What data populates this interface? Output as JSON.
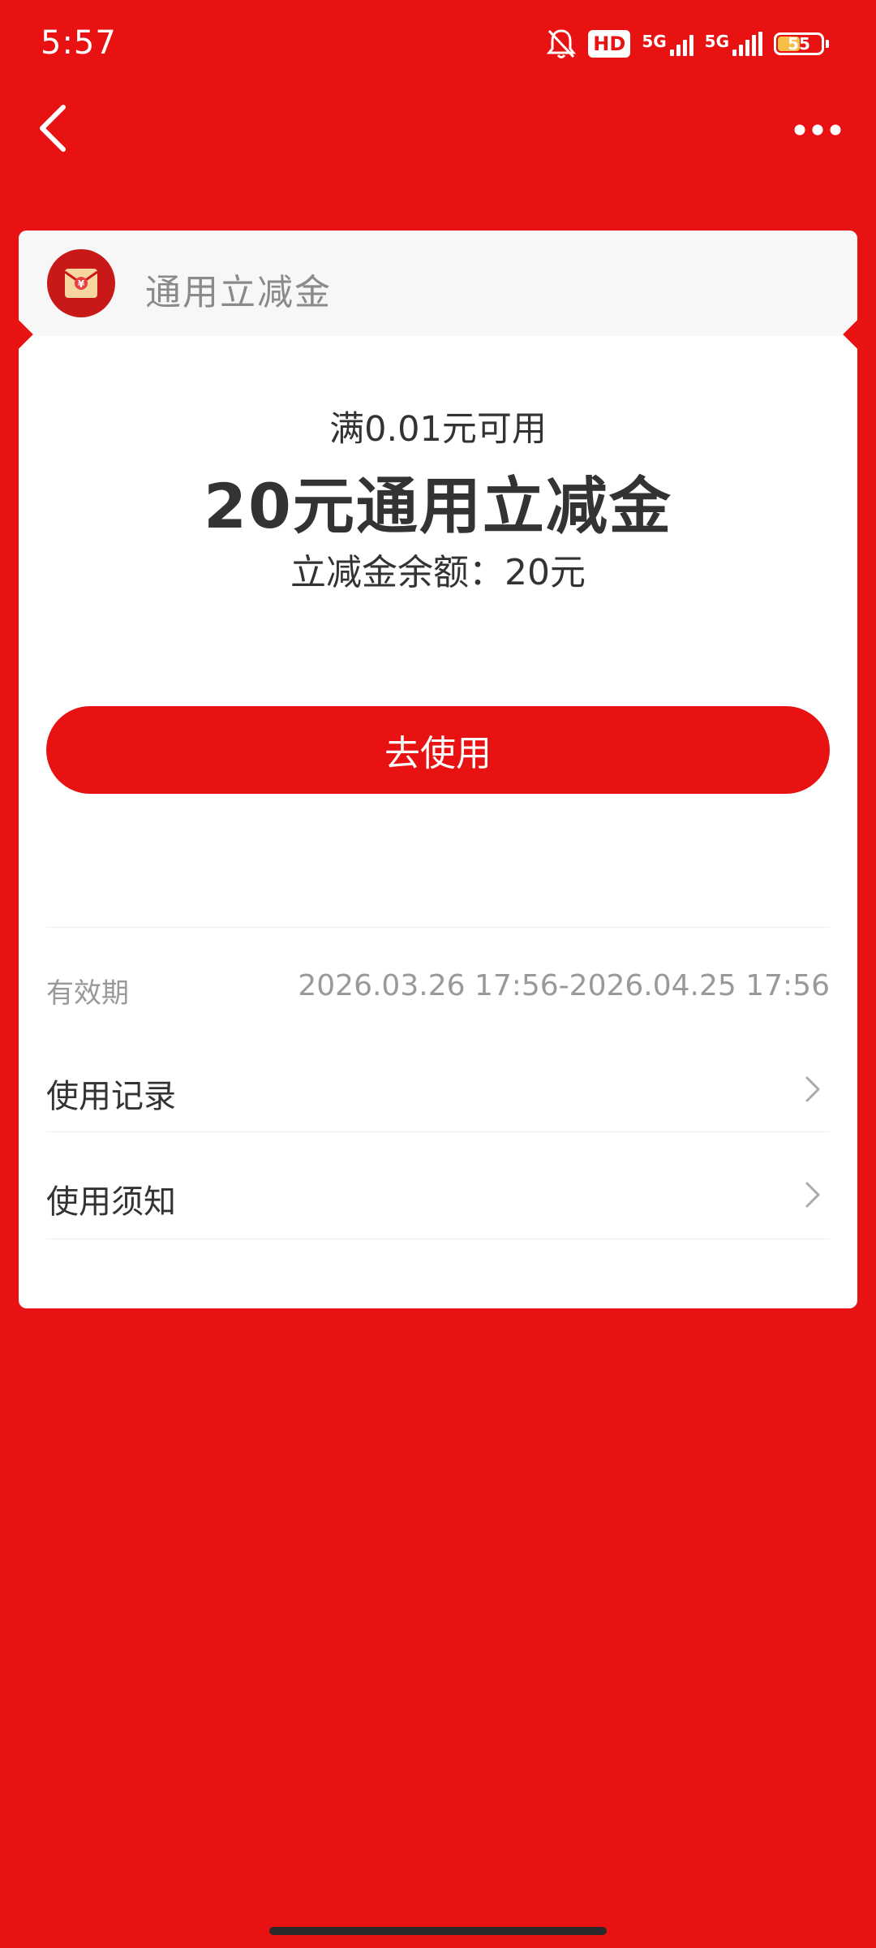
{
  "status_bar": {
    "time": "5:57",
    "hd_label": "HD",
    "network_1": "5G",
    "network_2": "5G",
    "battery_level": "55"
  },
  "nav": {
    "back_icon": "chevron-left-icon",
    "more_icon": "more-dots-icon"
  },
  "card": {
    "title": "通用立减金",
    "logo_icon": "red-envelope-yen-icon",
    "min_spend": "满0.01元可用",
    "amount": "20元通用立减金",
    "balance": "立减金余额：20元",
    "use_button": "去使用",
    "validity_label": "有效期",
    "validity_value": "2026.03.26 17:56-2026.04.25 17:56",
    "menu": [
      {
        "label": "使用记录",
        "icon": "chevron-right-icon"
      },
      {
        "label": "使用须知",
        "icon": "chevron-right-icon"
      }
    ]
  },
  "colors": {
    "brand_red": "#e81212",
    "battery_yellow": "#f6c046",
    "text_dark": "#333333",
    "text_muted": "#999999"
  }
}
